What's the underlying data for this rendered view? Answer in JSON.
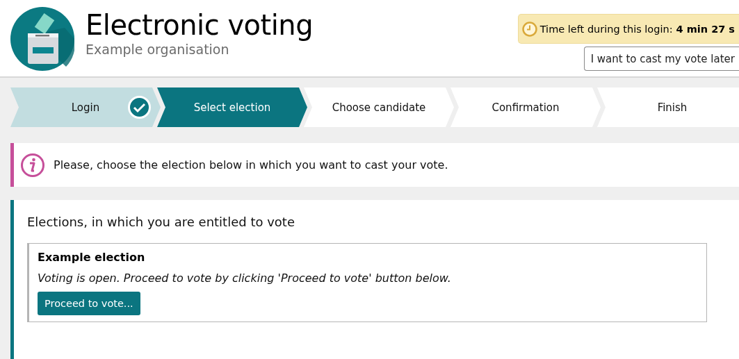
{
  "header": {
    "title": "Electronic voting",
    "subtitle": "Example organisation",
    "timer": {
      "label": "Time left during this login:",
      "value": "4 min 27 s"
    },
    "later_button": "I want to cast my vote later"
  },
  "steps": [
    {
      "label": "Login",
      "done": true,
      "selected": false
    },
    {
      "label": "Select election",
      "done": false,
      "selected": true
    },
    {
      "label": "Choose candidate",
      "done": false,
      "selected": false
    },
    {
      "label": "Confirmation",
      "done": false,
      "selected": false
    },
    {
      "label": "Finish",
      "done": false,
      "selected": false
    }
  ],
  "info": {
    "message": "Please, choose the election below in which you want to cast your vote."
  },
  "elections_panel": {
    "heading": "Elections, in which you are entitled to vote",
    "elections": [
      {
        "name": "Example election",
        "status_text": "Voting is open. Proceed to vote by clicking 'Proceed to vote' button below.",
        "button": "Proceed to vote..."
      }
    ]
  }
}
